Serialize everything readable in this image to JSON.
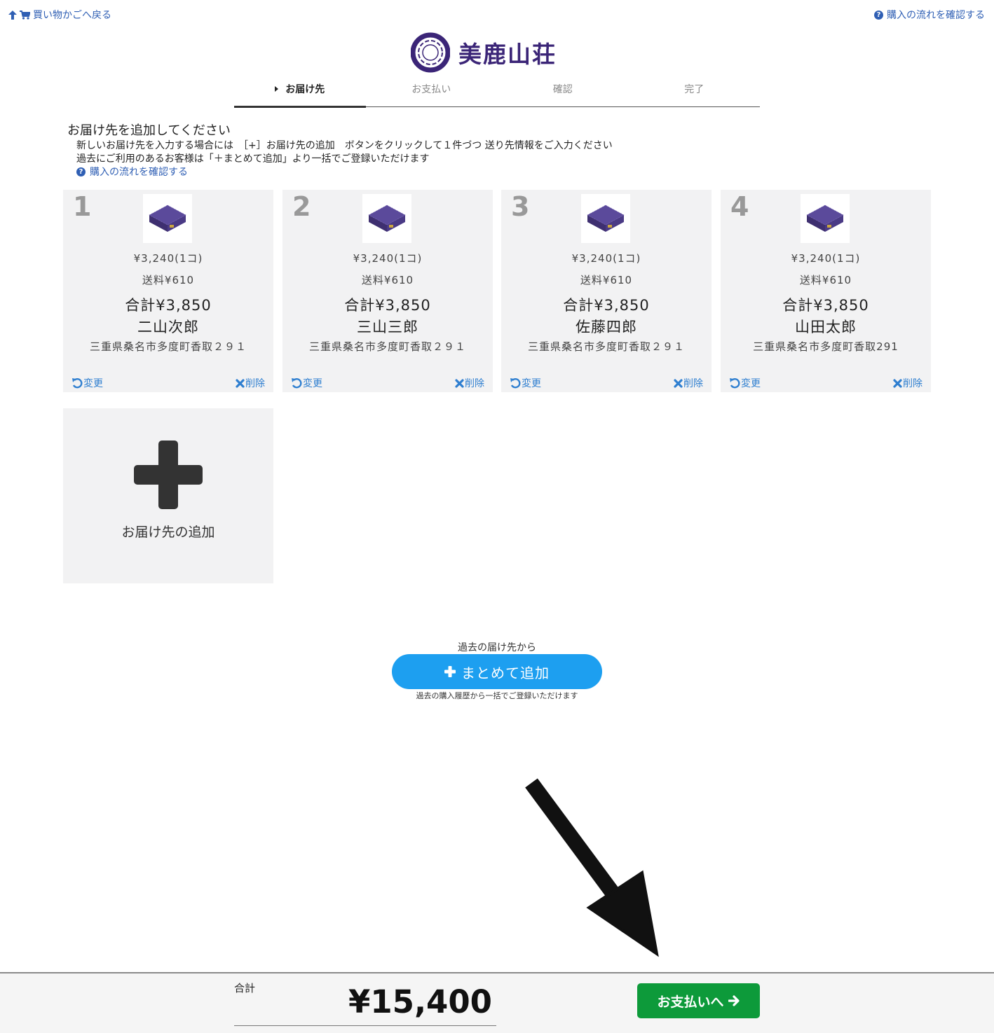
{
  "nav": {
    "back_label": "買い物かごへ戻る",
    "flow_label": "購入の流れを確認する"
  },
  "logo": {
    "text": "美鹿山荘"
  },
  "steps": [
    {
      "label": "お届け先",
      "active": true
    },
    {
      "label": "お支払い",
      "active": false
    },
    {
      "label": "確認",
      "active": false
    },
    {
      "label": "完了",
      "active": false
    }
  ],
  "intro": {
    "title": "お届け先を追加してください",
    "line1": "新しいお届け先を入力する場合には　［+］お届け先の追加　ボタンをクリックして１件づつ 送り先情報をご入力ください",
    "line2": "過去にご利用のあるお客様は「＋まとめて追加」より一括でご登録いただけます",
    "link": "購入の流れを確認する"
  },
  "destinations": [
    {
      "number": "1",
      "price": "¥3,240(1コ)",
      "shipping": "送料¥610",
      "total": "合計¥3,850",
      "name": "二山次郎",
      "address": "三重県桑名市多度町香取２９１",
      "edit_label": "変更",
      "delete_label": "削除"
    },
    {
      "number": "2",
      "price": "¥3,240(1コ)",
      "shipping": "送料¥610",
      "total": "合計¥3,850",
      "name": "三山三郎",
      "address": "三重県桑名市多度町香取２９１",
      "edit_label": "変更",
      "delete_label": "削除"
    },
    {
      "number": "3",
      "price": "¥3,240(1コ)",
      "shipping": "送料¥610",
      "total": "合計¥3,850",
      "name": "佐藤四郎",
      "address": "三重県桑名市多度町香取２９１",
      "edit_label": "変更",
      "delete_label": "削除"
    },
    {
      "number": "4",
      "price": "¥3,240(1コ)",
      "shipping": "送料¥610",
      "total": "合計¥3,850",
      "name": "山田太郎",
      "address": "三重県桑名市多度町香取291",
      "edit_label": "変更",
      "delete_label": "削除"
    }
  ],
  "add_destination": {
    "label": "お届け先の追加"
  },
  "bulk": {
    "caption": "過去の届け先から",
    "button_label": "まとめて追加",
    "note": "過去の購入履歴から一括でご登録いただけます"
  },
  "footer": {
    "total_label": "合計",
    "total_amount": "¥15,400",
    "pay_label": "お支払いへ"
  },
  "colors": {
    "link": "#2f5fb4",
    "bulk_button": "#1d9ff0",
    "pay_button": "#0d9a3a",
    "logo": "#3b2577",
    "card_bg": "#f2f2f3"
  },
  "icons": {
    "back": "arrow-up-icon",
    "cart": "cart-icon",
    "help": "question-circle-icon",
    "edit": "undo-icon",
    "delete": "close-icon",
    "add": "plus-icon",
    "pay": "arrow-right-icon"
  }
}
